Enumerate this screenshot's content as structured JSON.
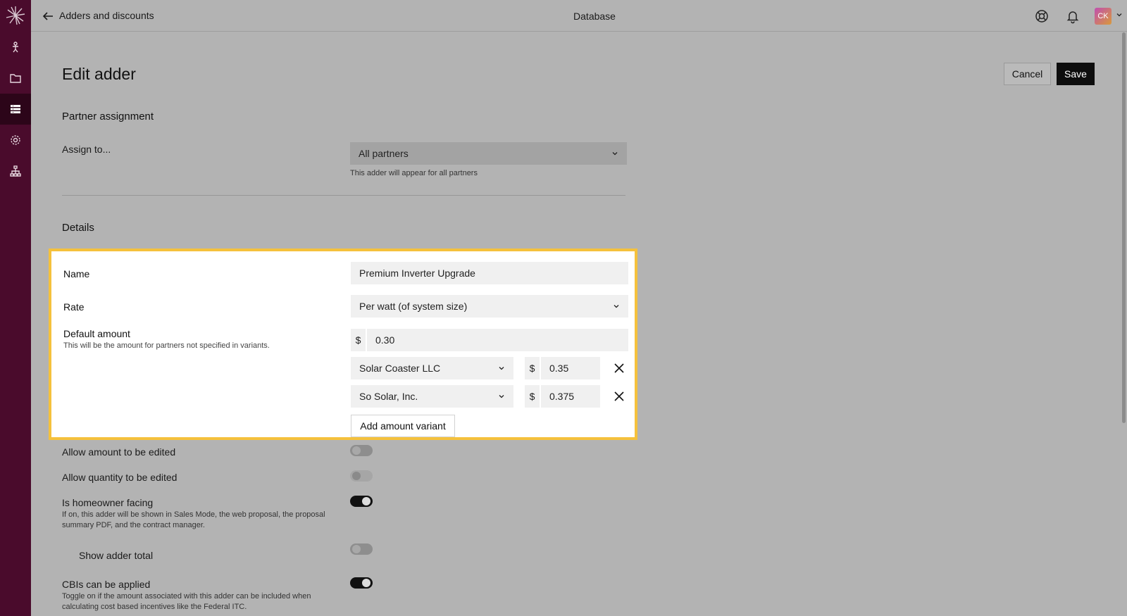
{
  "topbar": {
    "title": "Adders and discounts",
    "center": "Database",
    "avatar_initials": "CK"
  },
  "sidebar": {
    "items": [
      {
        "icon": "person-pin-icon"
      },
      {
        "icon": "folder-icon"
      },
      {
        "icon": "database-icon",
        "active": true
      },
      {
        "icon": "gear-icon"
      },
      {
        "icon": "org-chart-icon"
      }
    ]
  },
  "page": {
    "title": "Edit adder",
    "cancel_label": "Cancel",
    "save_label": "Save"
  },
  "partner_assignment": {
    "heading": "Partner assignment",
    "assign_label": "Assign to...",
    "assign_value": "All partners",
    "assign_hint": "This adder will appear for all partners"
  },
  "details": {
    "heading": "Details",
    "name_label": "Name",
    "name_value": "Premium Inverter Upgrade",
    "rate_label": "Rate",
    "rate_value": "Per watt (of system size)",
    "default_amount_label": "Default amount",
    "default_amount_hint": "This will be the amount for partners not specified in variants.",
    "currency_symbol": "$",
    "default_amount_value": "0.30",
    "variants": [
      {
        "partner": "Solar Coaster LLC",
        "amount": "0.35"
      },
      {
        "partner": "So Solar, Inc.",
        "amount": "0.375"
      }
    ],
    "add_variant_label": "Add amount variant"
  },
  "options": {
    "allow_amount_edit": {
      "label": "Allow amount to be edited",
      "on": false
    },
    "allow_quantity_edit": {
      "label": "Allow quantity to be edited",
      "on": false,
      "disabled": true
    },
    "homeowner_facing": {
      "label": "Is homeowner facing",
      "hint": "If on, this adder will be shown in Sales Mode, the web proposal, the proposal summary PDF, and the contract manager.",
      "on": true
    },
    "show_adder_total": {
      "label": "Show adder total",
      "on": false
    },
    "cbis": {
      "label": "CBIs can be applied",
      "hint": "Toggle on if the amount associated with this adder can be included when calculating cost based incentives like the Federal ITC.",
      "on": true
    }
  },
  "colors": {
    "sidebar": "#4a0b2c",
    "highlight_border": "#f5c13c",
    "save_button": "#0d0d0d"
  }
}
